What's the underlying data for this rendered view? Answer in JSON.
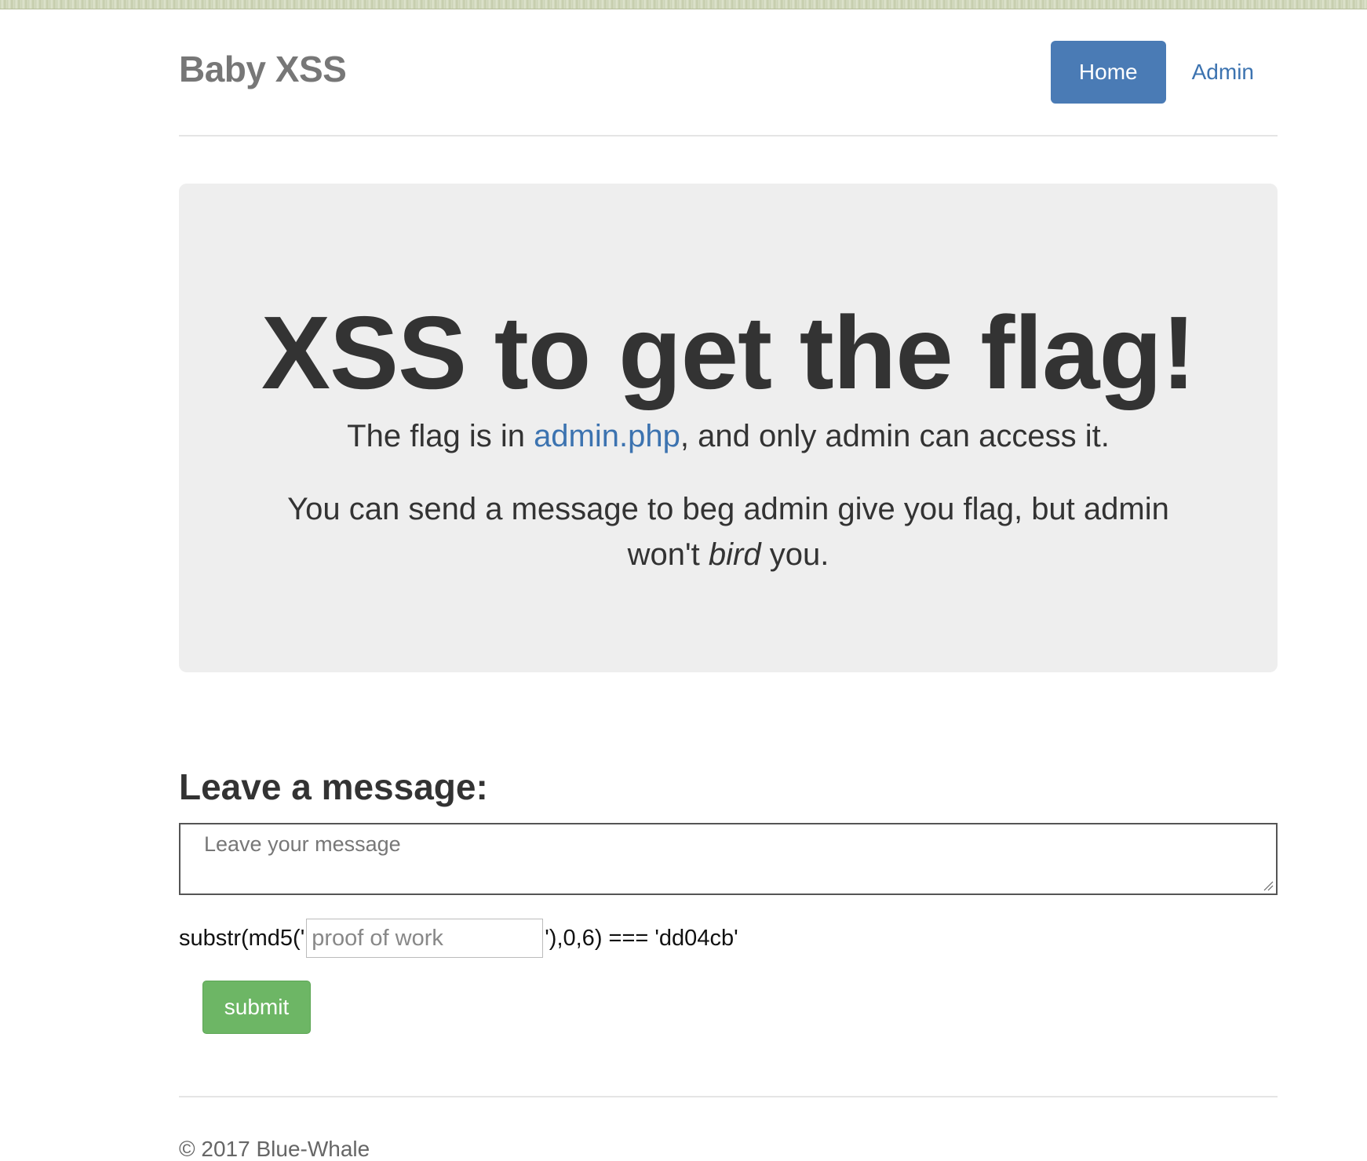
{
  "header": {
    "brand": "Baby XSS",
    "nav": {
      "home_label": "Home",
      "admin_label": "Admin"
    }
  },
  "jumbotron": {
    "title": "XSS to get the flag!",
    "line1_prefix": "The flag is in ",
    "line1_link": "admin.php",
    "line1_suffix": ", and only admin can access it.",
    "line2_prefix": "You can send a message to beg admin give you flag, but admin won't ",
    "line2_emphasis": "bird",
    "line2_suffix": " you."
  },
  "message_form": {
    "title": "Leave a message:",
    "message_placeholder": "Leave your message",
    "pow_prefix": "substr(md5('",
    "pow_placeholder": "proof of work",
    "pow_suffix": "'),0,6) === 'dd04cb'",
    "submit_label": "submit"
  },
  "footer": {
    "text": "© 2017 Blue-Whale"
  },
  "colors": {
    "primary": "#4a7bb5",
    "link": "#3c73b0",
    "success": "#6db665",
    "jumbotron_bg": "#eeeeee"
  }
}
